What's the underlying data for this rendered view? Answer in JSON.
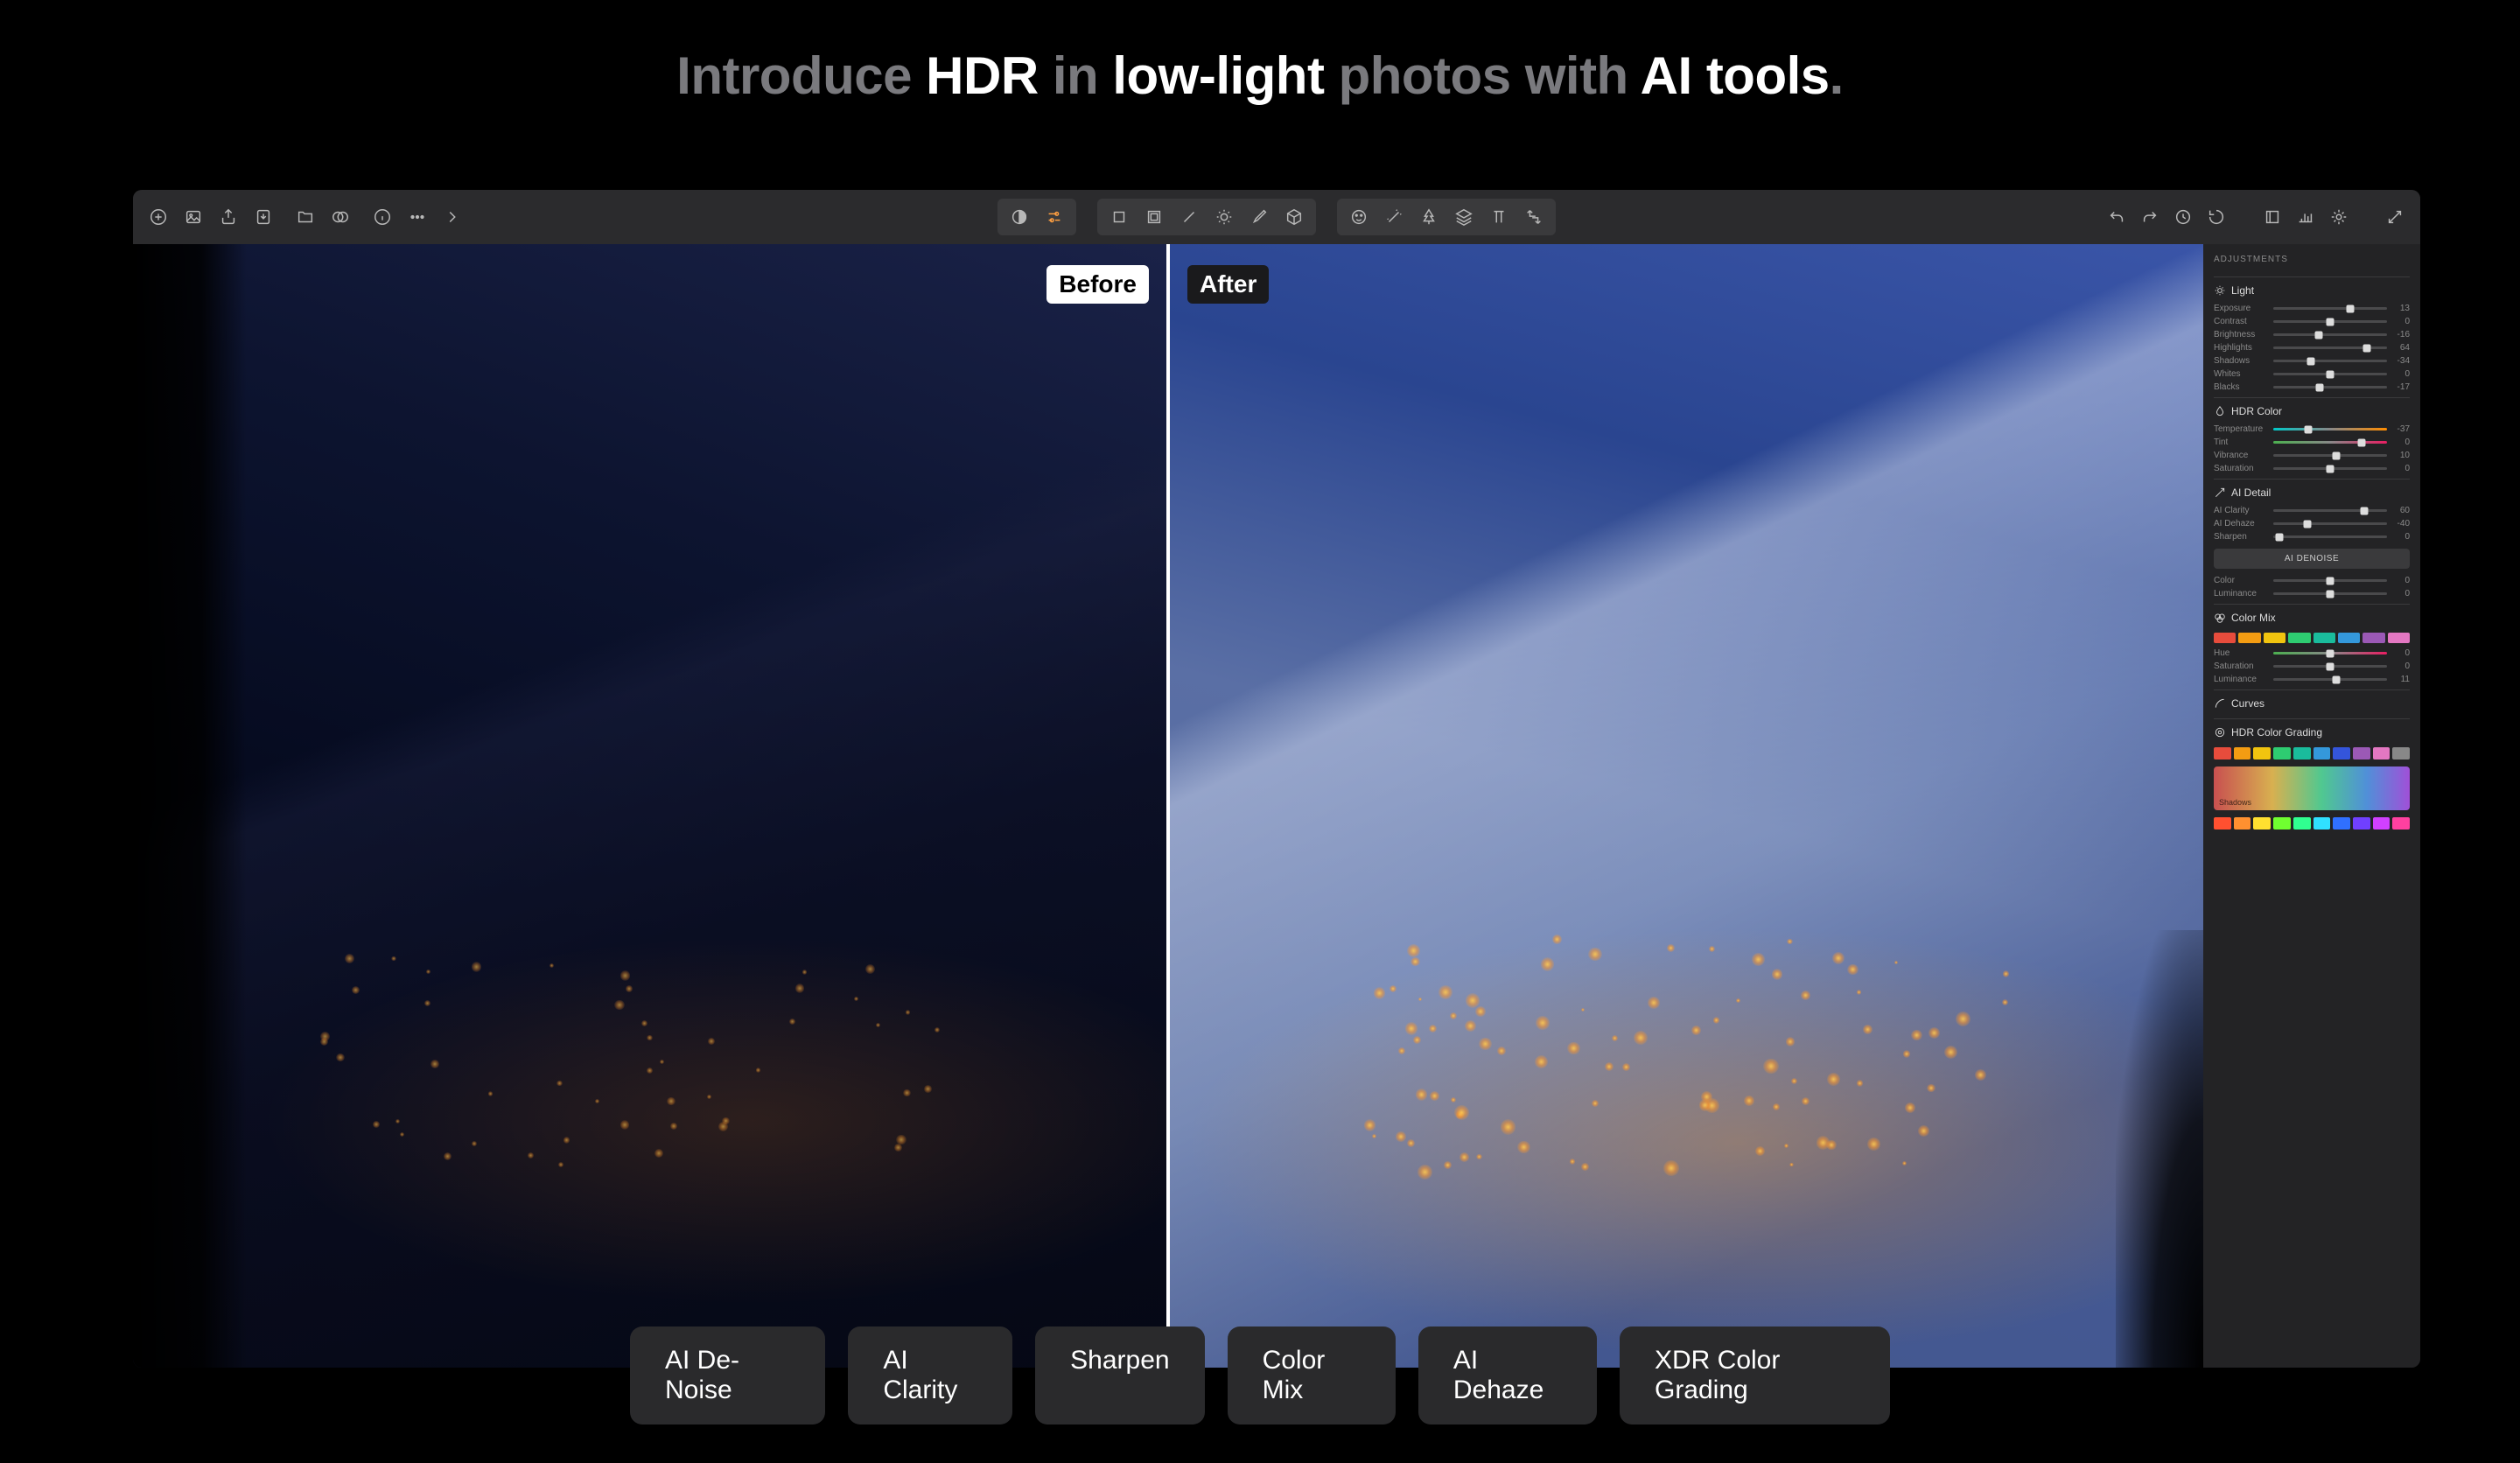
{
  "title_parts": [
    "Introduce ",
    "HDR",
    " in ",
    "low-light",
    " photos with ",
    "AI tools",
    "."
  ],
  "title_emphasis": [
    "dim",
    "bright",
    "dim",
    "bright",
    "dim",
    "bright",
    "dim"
  ],
  "labels": {
    "before": "Before",
    "after": "After"
  },
  "panel": {
    "title": "ADJUSTMENTS",
    "light": {
      "label": "Light",
      "sliders": [
        {
          "name": "Exposure",
          "value": 13,
          "pos": 68
        },
        {
          "name": "Contrast",
          "value": 0,
          "pos": 50
        },
        {
          "name": "Brightness",
          "value": -16,
          "pos": 40
        },
        {
          "name": "Highlights",
          "value": 64,
          "pos": 82
        },
        {
          "name": "Shadows",
          "value": -34,
          "pos": 33
        },
        {
          "name": "Whites",
          "value": 0,
          "pos": 50
        },
        {
          "name": "Blacks",
          "value": -17,
          "pos": 41
        }
      ]
    },
    "hdr_color": {
      "label": "HDR Color",
      "sliders": [
        {
          "name": "Temperature",
          "value": -37,
          "pos": 31,
          "track": "hue"
        },
        {
          "name": "Tint",
          "value": 0,
          "pos": 78,
          "track": "tint"
        },
        {
          "name": "Vibrance",
          "value": 10,
          "pos": 55
        },
        {
          "name": "Saturation",
          "value": 0,
          "pos": 50
        }
      ]
    },
    "ai_detail": {
      "label": "AI Detail",
      "sliders": [
        {
          "name": "AI Clarity",
          "value": 60,
          "pos": 80
        },
        {
          "name": "AI Dehaze",
          "value": -40,
          "pos": 30
        },
        {
          "name": "Sharpen",
          "value": 0,
          "pos": 5
        }
      ],
      "button": "AI DENOISE",
      "extra": [
        {
          "name": "Color",
          "value": 0,
          "pos": 50
        },
        {
          "name": "Luminance",
          "value": 0,
          "pos": 50
        }
      ]
    },
    "color_mix": {
      "label": "Color Mix",
      "swatches": [
        "#e74c3c",
        "#f39c12",
        "#f1c40f",
        "#2ecc71",
        "#1abc9c",
        "#3498db",
        "#9b59b6",
        "#e377c2"
      ],
      "sliders": [
        {
          "name": "Hue",
          "value": 0,
          "pos": 50,
          "track": "tint"
        },
        {
          "name": "Saturation",
          "value": 0,
          "pos": 50
        },
        {
          "name": "Luminance",
          "value": 11,
          "pos": 55
        }
      ]
    },
    "curves": {
      "label": "Curves"
    },
    "hdr_grading": {
      "label": "HDR Color Grading",
      "swatches_top": [
        "#e74c3c",
        "#f39c12",
        "#f1c40f",
        "#2ecc71",
        "#1abc9c",
        "#3498db",
        "#3455db",
        "#9b59b6",
        "#e377c2",
        "#888"
      ],
      "swatches_bot": [
        "#ff5030",
        "#ff9030",
        "#ffe030",
        "#70ff30",
        "#30ff90",
        "#30e0ff",
        "#3070ff",
        "#7040ff",
        "#d040ff",
        "#ff40a0"
      ]
    }
  },
  "features": [
    "AI De-Noise",
    "AI Clarity",
    "Sharpen",
    "Color Mix",
    "AI Dehaze",
    "XDR Color Grading"
  ]
}
